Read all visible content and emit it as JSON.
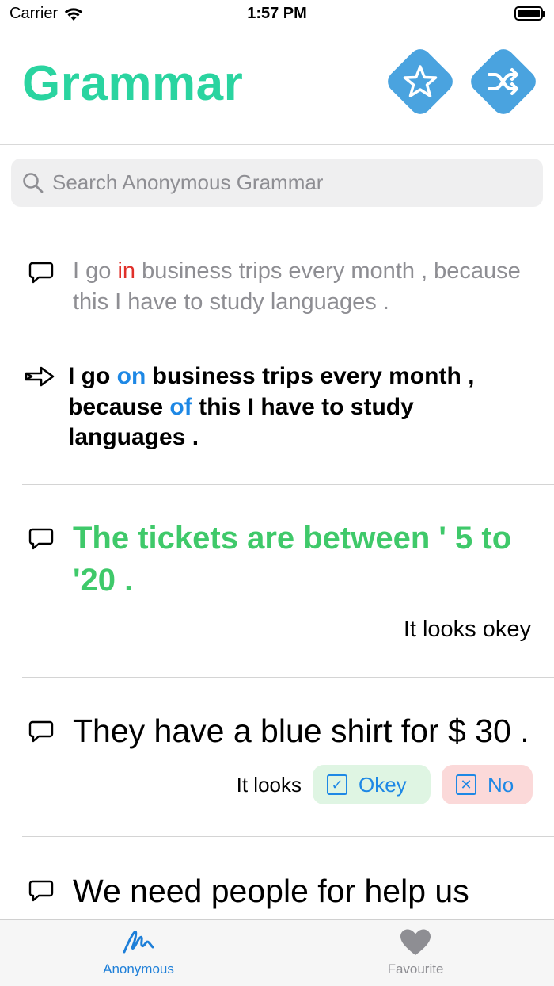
{
  "status_bar": {
    "carrier": "Carrier",
    "time": "1:57 PM"
  },
  "header": {
    "title": "Grammar",
    "title_color": "#2ad4a0",
    "accent_color": "#4aa3df",
    "favourite_icon": "star-icon",
    "shuffle_icon": "shuffle-icon"
  },
  "search": {
    "placeholder": "Search Anonymous Grammar",
    "value": ""
  },
  "entries": [
    {
      "original": {
        "before": "I go ",
        "error": "in",
        "after": " business trips every month , because  this  I  have to study languages ."
      },
      "corrected": {
        "part1": "I go ",
        "fix1": "on",
        "part2": " business trips every month , because ",
        "fix2": "of",
        "part3": " this  I  have to study languages ."
      }
    },
    {
      "sentence": "The tickets are between ' 5 to '20 .",
      "note": "It looks okey"
    },
    {
      "sentence": "They have a blue shirt for $ 30 .",
      "looks_label": "It looks",
      "okey_label": "Okey",
      "no_label": "No"
    },
    {
      "sentence": "We need people for help us"
    }
  ],
  "tab_bar": {
    "tabs": [
      {
        "label": "Anonymous",
        "icon": "scribble-icon",
        "active": true
      },
      {
        "label": "Favourite",
        "icon": "heart-icon",
        "active": false
      }
    ]
  }
}
